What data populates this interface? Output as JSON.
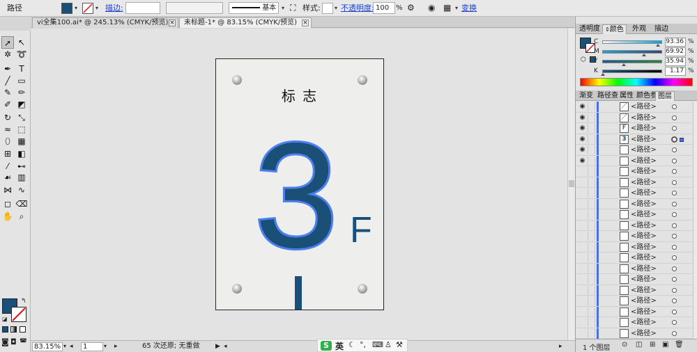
{
  "control_bar": {
    "selection_label": "路径",
    "stroke_link": "描边:",
    "stroke_weight": "",
    "brush_style": "",
    "stroke_profile": "基本",
    "style_label": "样式:",
    "opacity_link": "不透明度:",
    "opacity_value": "100",
    "opacity_unit": "%",
    "transform_link": "变换",
    "fill_color": "#1a5077"
  },
  "doc_tabs": [
    {
      "label": "vi全集100.ai* @ 245.13% (CMYK/预览)",
      "close": "×"
    },
    {
      "label": "未标题-1* @ 83.15% (CMYK/预览)",
      "close": "×"
    }
  ],
  "artboard": {
    "title": "标 志",
    "floor_number": "3",
    "floor_letter": "F",
    "number_fill": "#1a5077",
    "number_stroke": "#4e7ff0"
  },
  "status_bar": {
    "zoom": "83.15%",
    "page": "1",
    "undo_status": "65 次还原; 无重做"
  },
  "ime": {
    "logo": "S",
    "lang": "英"
  },
  "color_panel": {
    "tabs": [
      "透明度",
      "颜色",
      "外观",
      "描边"
    ],
    "active_tab": "颜色",
    "channels": [
      {
        "label": "C",
        "value": "93.36",
        "knob": 0.9336
      },
      {
        "label": "M",
        "value": "69.92",
        "knob": 0.6992
      },
      {
        "label": "Y",
        "value": "35.94",
        "knob": 0.3594
      },
      {
        "label": "K",
        "value": "1.17",
        "knob": 0.0117
      }
    ],
    "percent": "%"
  },
  "layers_panel": {
    "tabs": [
      "渐变",
      "路径查",
      "属性",
      "颜色参",
      "图层"
    ],
    "active_tab": "图层",
    "footer_count": "1 个图层",
    "rows": [
      {
        "name": "<路径>",
        "eye": true,
        "thumb": "／",
        "selected": false
      },
      {
        "name": "<路径>",
        "eye": true,
        "thumb": "／",
        "selected": false
      },
      {
        "name": "<路径>",
        "eye": true,
        "thumb": "F",
        "selected": false
      },
      {
        "name": "<路径>",
        "eye": true,
        "thumb": "3",
        "selected": true
      },
      {
        "name": "<路径>",
        "eye": true,
        "thumb": "",
        "selected": false
      },
      {
        "name": "<路径>",
        "eye": true,
        "thumb": "",
        "selected": false
      },
      {
        "name": "<路径>",
        "eye": false,
        "thumb": "",
        "selected": false
      },
      {
        "name": "<路径>",
        "eye": false,
        "thumb": "",
        "selected": false
      },
      {
        "name": "<路径>",
        "eye": false,
        "thumb": "",
        "selected": false
      },
      {
        "name": "<路径>",
        "eye": false,
        "thumb": "",
        "selected": false
      },
      {
        "name": "<路径>",
        "eye": false,
        "thumb": "",
        "selected": false
      },
      {
        "name": "<路径>",
        "eye": false,
        "thumb": "",
        "selected": false
      },
      {
        "name": "<路径>",
        "eye": false,
        "thumb": "",
        "selected": false
      },
      {
        "name": "<路径>",
        "eye": false,
        "thumb": "",
        "selected": false
      },
      {
        "name": "<路径>",
        "eye": false,
        "thumb": "",
        "selected": false
      },
      {
        "name": "<路径>",
        "eye": false,
        "thumb": "",
        "selected": false
      },
      {
        "name": "<路径>",
        "eye": false,
        "thumb": "",
        "selected": false
      },
      {
        "name": "<路径>",
        "eye": false,
        "thumb": "",
        "selected": false
      },
      {
        "name": "<路径>",
        "eye": false,
        "thumb": "",
        "selected": false
      },
      {
        "name": "<路径>",
        "eye": false,
        "thumb": "",
        "selected": false
      },
      {
        "name": "<路径>",
        "eye": false,
        "thumb": "",
        "selected": false
      },
      {
        "name": "<路径>",
        "eye": false,
        "thumb": "",
        "selected": false
      }
    ]
  },
  "tools": [
    "selection-tool",
    "direct-selection-tool",
    "magic-wand-tool",
    "lasso-tool",
    "pen-tool",
    "type-tool",
    "line-segment-tool",
    "rectangle-tool",
    "paintbrush-tool",
    "pencil-tool",
    "blob-brush-tool",
    "eraser-tool",
    "rotate-tool",
    "scale-tool",
    "warp-tool",
    "free-transform-tool",
    "shape-builder-tool",
    "perspective-grid-tool",
    "mesh-tool",
    "gradient-tool",
    "eyedropper-tool",
    "blend-tool",
    "symbol-sprayer-tool",
    "column-graph-tool",
    "width-tool",
    "width-variant-tool",
    "artboard-tool",
    "slice-tool",
    "hand-tool",
    "zoom-tool"
  ]
}
